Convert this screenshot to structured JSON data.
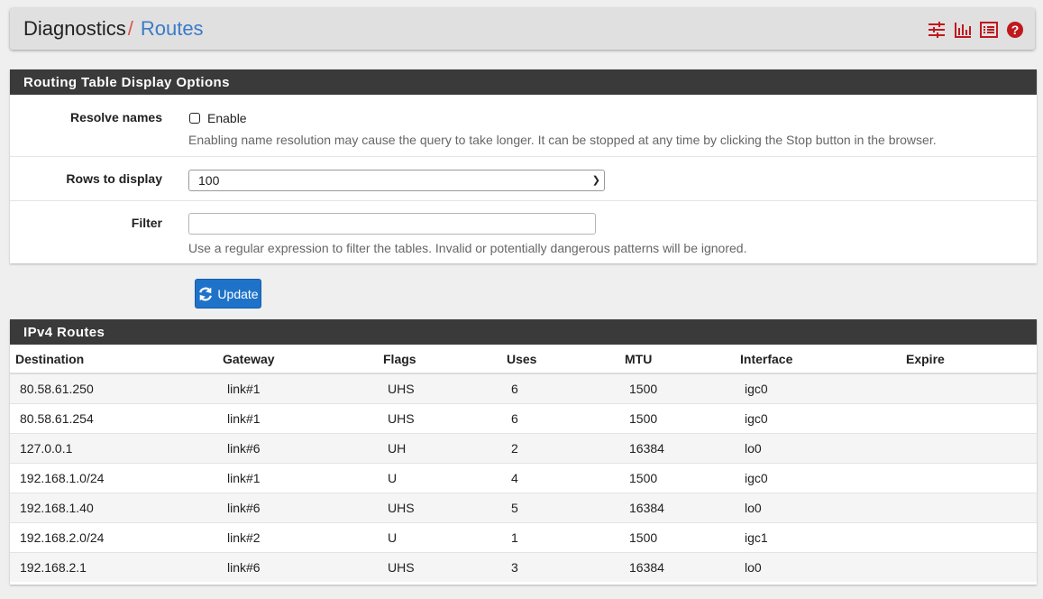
{
  "header": {
    "crumb_parent": "Diagnostics",
    "crumb_sep": "/",
    "crumb_current": "Routes",
    "icons": [
      "sliders-icon",
      "bar-chart-icon",
      "list-icon",
      "help-icon"
    ],
    "icon_color": "#c0181e"
  },
  "options_panel": {
    "title": "Routing Table Display Options",
    "resolve": {
      "label": "Resolve names",
      "checkbox_label": "Enable",
      "help": "Enabling name resolution may cause the query to take longer. It can be stopped at any time by clicking the Stop button in the browser."
    },
    "rows": {
      "label": "Rows to display",
      "selected": "100"
    },
    "filter": {
      "label": "Filter",
      "value": "",
      "help": "Use a regular expression to filter the tables. Invalid or potentially dangerous patterns will be ignored."
    },
    "update_label": "Update"
  },
  "ipv4_panel": {
    "title": "IPv4 Routes",
    "columns": [
      "Destination",
      "Gateway",
      "Flags",
      "Uses",
      "MTU",
      "Interface",
      "Expire"
    ],
    "rows": [
      [
        "80.58.61.250",
        "link#1",
        "UHS",
        "6",
        "1500",
        "igc0",
        ""
      ],
      [
        "80.58.61.254",
        "link#1",
        "UHS",
        "6",
        "1500",
        "igc0",
        ""
      ],
      [
        "127.0.0.1",
        "link#6",
        "UH",
        "2",
        "16384",
        "lo0",
        ""
      ],
      [
        "192.168.1.0/24",
        "link#1",
        "U",
        "4",
        "1500",
        "igc0",
        ""
      ],
      [
        "192.168.1.40",
        "link#6",
        "UHS",
        "5",
        "16384",
        "lo0",
        ""
      ],
      [
        "192.168.2.0/24",
        "link#2",
        "U",
        "1",
        "1500",
        "igc1",
        ""
      ],
      [
        "192.168.2.1",
        "link#6",
        "UHS",
        "3",
        "16384",
        "lo0",
        ""
      ]
    ]
  },
  "colors": {
    "panel_head": "#3a3a3a",
    "button": "#1e73c9",
    "link": "#3a7bc8"
  }
}
